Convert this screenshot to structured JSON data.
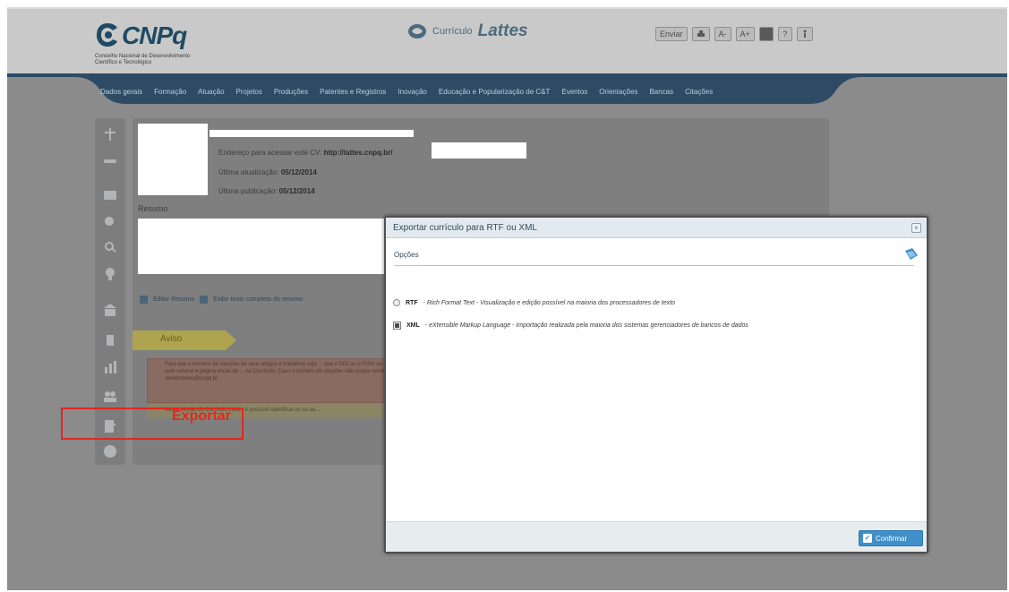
{
  "header": {
    "logo_text": "CNPq",
    "logo_subtitle": "Conselho Nacional de Desenvolvimento Científico e Tecnológico",
    "app_small": "Currículo",
    "app_big": "Lattes",
    "toolbar": [
      {
        "label": "Enviar",
        "icon": "email-icon"
      },
      {
        "label": "",
        "icon": "print-icon"
      },
      {
        "label": "A-",
        "icon": "font-decrease-icon"
      },
      {
        "label": "A+",
        "icon": "font-increase-icon"
      },
      {
        "label": "",
        "icon": "contrast-icon"
      },
      {
        "label": "?",
        "icon": "help-icon"
      },
      {
        "label": "",
        "icon": "accessibility-icon"
      }
    ]
  },
  "nav": {
    "items": [
      "Dados gerais",
      "Formação",
      "Atuação",
      "Projetos",
      "Produções",
      "Patentes e Registros",
      "Inovação",
      "Educação e Popularização de C&T",
      "Eventos",
      "Orientações",
      "Bancas",
      "Citações"
    ]
  },
  "profile": {
    "cv_address_label": "Endereço para acessar este CV:",
    "cv_address_value": "http://lattes.cnpq.br/",
    "last_update_label": "Última atualização:",
    "last_update_value": "05/12/2014",
    "last_publish_label": "Última publicação:",
    "last_publish_value": "05/12/2014",
    "resumo_label": "Resumo",
    "edit_resumo": "Editar Resumo",
    "edit_full_text": "Exibir texto completo do resumo"
  },
  "aviso": {
    "tag": "Aviso",
    "warning_text": "Para que o número de citações de seus artigos e trabalhos seja ... que o DOI ou o ISSN da revista com volume e página inicial do ... no Currículo. Caso o número de citações não esteja sendo ... atendimento@cnpq.br",
    "info_text": "Nesta versão do Currículo Lattes é possível identificar os co-au..."
  },
  "annotation": {
    "label": "Exportar",
    "color": "#e0271f"
  },
  "modal": {
    "title": "Exportar currículo para RTF ou XML",
    "section": "Opções",
    "options": [
      {
        "code": "RTF",
        "desc_italic": "Rich Format Text",
        "desc": " - Visualização e edição possível na maioria dos processadores de texto",
        "selected": false
      },
      {
        "code": "XML",
        "desc_italic": "eXtensible Markup Language",
        "desc": " - Importação realizada pela maioria dos sistemas gerenciadores de bancos de dados",
        "selected": true
      }
    ],
    "confirm_label": "Confirmar"
  },
  "colors": {
    "nav_bar": "#2f4b64",
    "accent_button": "#3f8fc9"
  }
}
